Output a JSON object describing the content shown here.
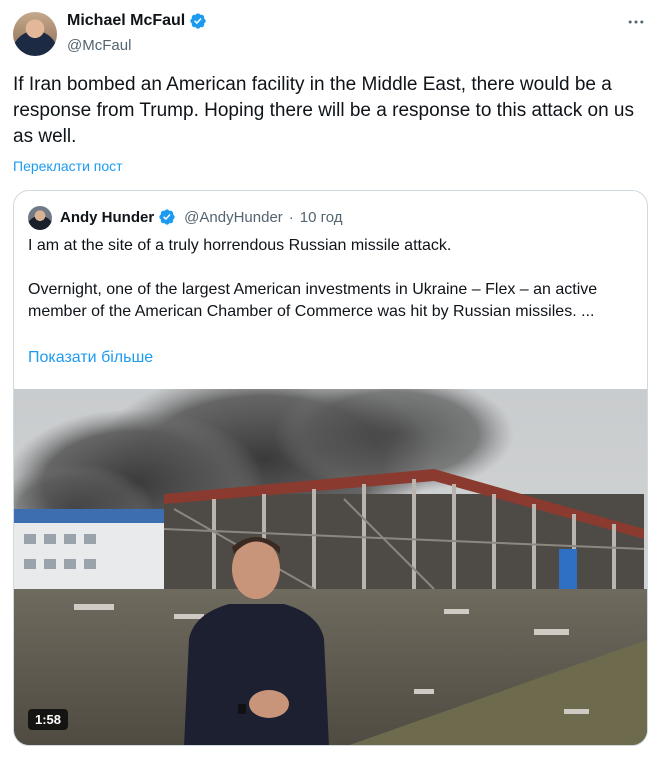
{
  "author": {
    "name": "Michael McFaul",
    "handle": "@McFaul",
    "verified": true
  },
  "tweet": {
    "text": "If Iran bombed an American facility in the Middle East, there would be a response from Trump. Hoping there will be a response to this attack on us as well.",
    "translate_label": "Перекласти пост"
  },
  "quote": {
    "name": "Andy Hunder",
    "handle": "@AndyHunder",
    "separator": "·",
    "time": "10 год",
    "verified": true,
    "paragraph1": "I am at the site of a truly horrendous Russian missile attack.",
    "paragraph2": "Overnight, one  of the largest American investments in Ukraine – Flex – an active member of the American Chamber of Commerce was hit by Russian missiles. ...",
    "show_more_label": "Показати більше",
    "video": {
      "duration": "1:58"
    }
  },
  "icons": {
    "more": "more-icon",
    "verified": "verified-badge-icon"
  },
  "colors": {
    "link": "#1d9bf0",
    "verified": "#1d9bf0",
    "secondary_text": "#536471",
    "border": "#cfd9de"
  }
}
